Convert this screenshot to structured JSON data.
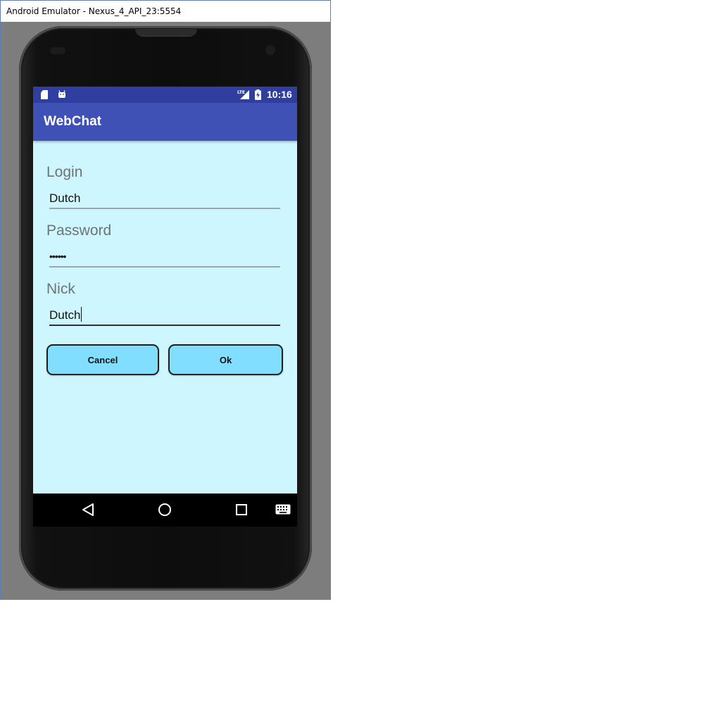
{
  "window": {
    "title": "Android Emulator - Nexus_4_API_23:5554"
  },
  "status_bar": {
    "time": "10:16",
    "network": "LTE",
    "icons": [
      "sd-card-icon",
      "android-debug-icon",
      "lte-signal-icon",
      "battery-charging-icon"
    ]
  },
  "app_bar": {
    "title": "WebChat"
  },
  "form": {
    "login": {
      "label": "Login",
      "value": "Dutch"
    },
    "password": {
      "label": "Password",
      "value": "••••••"
    },
    "nick": {
      "label": "Nick",
      "value": "Dutch"
    }
  },
  "buttons": {
    "cancel_label": "Cancel",
    "ok_label": "Ok"
  },
  "nav_bar": {
    "icons": [
      "back-icon",
      "home-icon",
      "recents-icon",
      "keyboard-icon"
    ]
  },
  "colors": {
    "status_bar": "#303f9f",
    "app_bar": "#3f51b5",
    "screen_background": "#cdf6fe",
    "button_fill": "#82defe"
  }
}
